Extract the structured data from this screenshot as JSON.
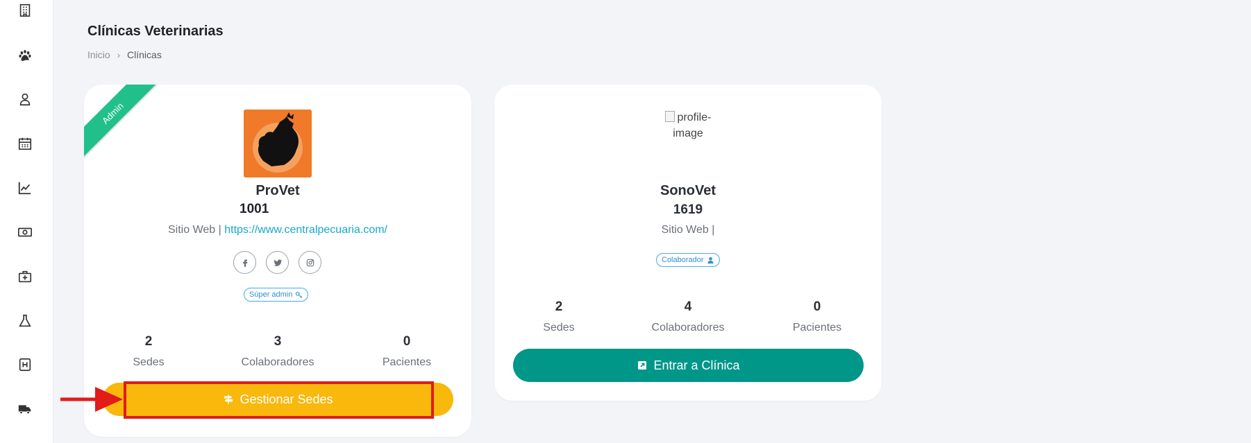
{
  "sidebar": {
    "items": [
      {
        "icon": "building-icon"
      },
      {
        "icon": "paw-icon"
      },
      {
        "icon": "user-icon"
      },
      {
        "icon": "calendar-icon"
      },
      {
        "icon": "chart-line-icon"
      },
      {
        "icon": "money-icon"
      },
      {
        "icon": "medkit-icon"
      },
      {
        "icon": "flask-icon"
      },
      {
        "icon": "hospital-icon"
      },
      {
        "icon": "truck-icon"
      }
    ]
  },
  "header": {
    "title": "Clínicas Veterinarias",
    "breadcrumb": {
      "home": "Inicio",
      "separator": "›",
      "current": "Clínicas"
    }
  },
  "clinics": [
    {
      "ribbon": "Admin",
      "name": "ProVet",
      "code": "1001",
      "website_label": "Sitio Web |",
      "website_url": "https://www.centralpecuaria.com/",
      "role_badge": "Súper admin",
      "stats": [
        {
          "value": "2",
          "label": "Sedes"
        },
        {
          "value": "3",
          "label": "Colaboradores"
        },
        {
          "value": "0",
          "label": "Pacientes"
        }
      ],
      "button_label": "Gestionar Sedes"
    },
    {
      "image_alt": "profile-image",
      "name": "SonoVet",
      "code": "1619",
      "website_label": "Sitio Web |",
      "role_badge": "Colaborador",
      "stats": [
        {
          "value": "2",
          "label": "Sedes"
        },
        {
          "value": "4",
          "label": "Colaboradores"
        },
        {
          "value": "0",
          "label": "Pacientes"
        }
      ],
      "button_label": "Entrar a Clínica"
    }
  ],
  "colors": {
    "accent_yellow": "#f8b80c",
    "accent_teal": "#009688",
    "ribbon_green": "#21c08b",
    "annotation_red": "#e21b1b",
    "link_blue": "#16a9c8"
  }
}
